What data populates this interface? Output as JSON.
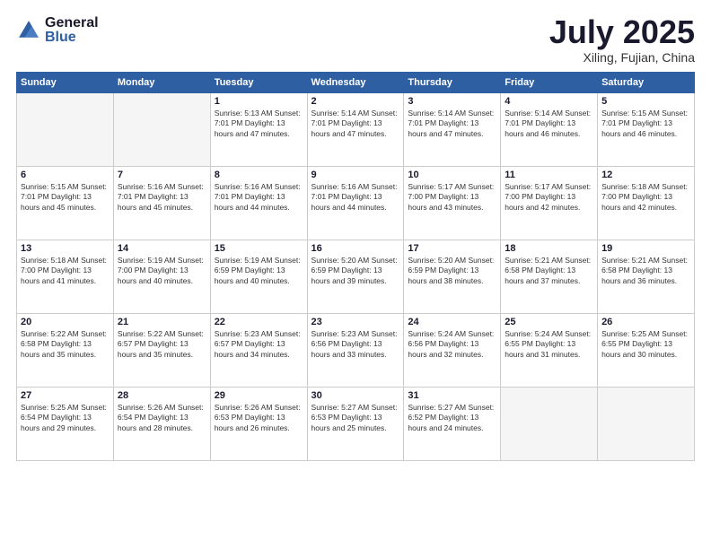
{
  "header": {
    "logo_general": "General",
    "logo_blue": "Blue",
    "title": "July 2025",
    "location": "Xiling, Fujian, China"
  },
  "weekdays": [
    "Sunday",
    "Monday",
    "Tuesday",
    "Wednesday",
    "Thursday",
    "Friday",
    "Saturday"
  ],
  "weeks": [
    [
      {
        "day": "",
        "info": ""
      },
      {
        "day": "",
        "info": ""
      },
      {
        "day": "1",
        "info": "Sunrise: 5:13 AM\nSunset: 7:01 PM\nDaylight: 13 hours\nand 47 minutes."
      },
      {
        "day": "2",
        "info": "Sunrise: 5:14 AM\nSunset: 7:01 PM\nDaylight: 13 hours\nand 47 minutes."
      },
      {
        "day": "3",
        "info": "Sunrise: 5:14 AM\nSunset: 7:01 PM\nDaylight: 13 hours\nand 47 minutes."
      },
      {
        "day": "4",
        "info": "Sunrise: 5:14 AM\nSunset: 7:01 PM\nDaylight: 13 hours\nand 46 minutes."
      },
      {
        "day": "5",
        "info": "Sunrise: 5:15 AM\nSunset: 7:01 PM\nDaylight: 13 hours\nand 46 minutes."
      }
    ],
    [
      {
        "day": "6",
        "info": "Sunrise: 5:15 AM\nSunset: 7:01 PM\nDaylight: 13 hours\nand 45 minutes."
      },
      {
        "day": "7",
        "info": "Sunrise: 5:16 AM\nSunset: 7:01 PM\nDaylight: 13 hours\nand 45 minutes."
      },
      {
        "day": "8",
        "info": "Sunrise: 5:16 AM\nSunset: 7:01 PM\nDaylight: 13 hours\nand 44 minutes."
      },
      {
        "day": "9",
        "info": "Sunrise: 5:16 AM\nSunset: 7:01 PM\nDaylight: 13 hours\nand 44 minutes."
      },
      {
        "day": "10",
        "info": "Sunrise: 5:17 AM\nSunset: 7:00 PM\nDaylight: 13 hours\nand 43 minutes."
      },
      {
        "day": "11",
        "info": "Sunrise: 5:17 AM\nSunset: 7:00 PM\nDaylight: 13 hours\nand 42 minutes."
      },
      {
        "day": "12",
        "info": "Sunrise: 5:18 AM\nSunset: 7:00 PM\nDaylight: 13 hours\nand 42 minutes."
      }
    ],
    [
      {
        "day": "13",
        "info": "Sunrise: 5:18 AM\nSunset: 7:00 PM\nDaylight: 13 hours\nand 41 minutes."
      },
      {
        "day": "14",
        "info": "Sunrise: 5:19 AM\nSunset: 7:00 PM\nDaylight: 13 hours\nand 40 minutes."
      },
      {
        "day": "15",
        "info": "Sunrise: 5:19 AM\nSunset: 6:59 PM\nDaylight: 13 hours\nand 40 minutes."
      },
      {
        "day": "16",
        "info": "Sunrise: 5:20 AM\nSunset: 6:59 PM\nDaylight: 13 hours\nand 39 minutes."
      },
      {
        "day": "17",
        "info": "Sunrise: 5:20 AM\nSunset: 6:59 PM\nDaylight: 13 hours\nand 38 minutes."
      },
      {
        "day": "18",
        "info": "Sunrise: 5:21 AM\nSunset: 6:58 PM\nDaylight: 13 hours\nand 37 minutes."
      },
      {
        "day": "19",
        "info": "Sunrise: 5:21 AM\nSunset: 6:58 PM\nDaylight: 13 hours\nand 36 minutes."
      }
    ],
    [
      {
        "day": "20",
        "info": "Sunrise: 5:22 AM\nSunset: 6:58 PM\nDaylight: 13 hours\nand 35 minutes."
      },
      {
        "day": "21",
        "info": "Sunrise: 5:22 AM\nSunset: 6:57 PM\nDaylight: 13 hours\nand 35 minutes."
      },
      {
        "day": "22",
        "info": "Sunrise: 5:23 AM\nSunset: 6:57 PM\nDaylight: 13 hours\nand 34 minutes."
      },
      {
        "day": "23",
        "info": "Sunrise: 5:23 AM\nSunset: 6:56 PM\nDaylight: 13 hours\nand 33 minutes."
      },
      {
        "day": "24",
        "info": "Sunrise: 5:24 AM\nSunset: 6:56 PM\nDaylight: 13 hours\nand 32 minutes."
      },
      {
        "day": "25",
        "info": "Sunrise: 5:24 AM\nSunset: 6:55 PM\nDaylight: 13 hours\nand 31 minutes."
      },
      {
        "day": "26",
        "info": "Sunrise: 5:25 AM\nSunset: 6:55 PM\nDaylight: 13 hours\nand 30 minutes."
      }
    ],
    [
      {
        "day": "27",
        "info": "Sunrise: 5:25 AM\nSunset: 6:54 PM\nDaylight: 13 hours\nand 29 minutes."
      },
      {
        "day": "28",
        "info": "Sunrise: 5:26 AM\nSunset: 6:54 PM\nDaylight: 13 hours\nand 28 minutes."
      },
      {
        "day": "29",
        "info": "Sunrise: 5:26 AM\nSunset: 6:53 PM\nDaylight: 13 hours\nand 26 minutes."
      },
      {
        "day": "30",
        "info": "Sunrise: 5:27 AM\nSunset: 6:53 PM\nDaylight: 13 hours\nand 25 minutes."
      },
      {
        "day": "31",
        "info": "Sunrise: 5:27 AM\nSunset: 6:52 PM\nDaylight: 13 hours\nand 24 minutes."
      },
      {
        "day": "",
        "info": ""
      },
      {
        "day": "",
        "info": ""
      }
    ]
  ]
}
